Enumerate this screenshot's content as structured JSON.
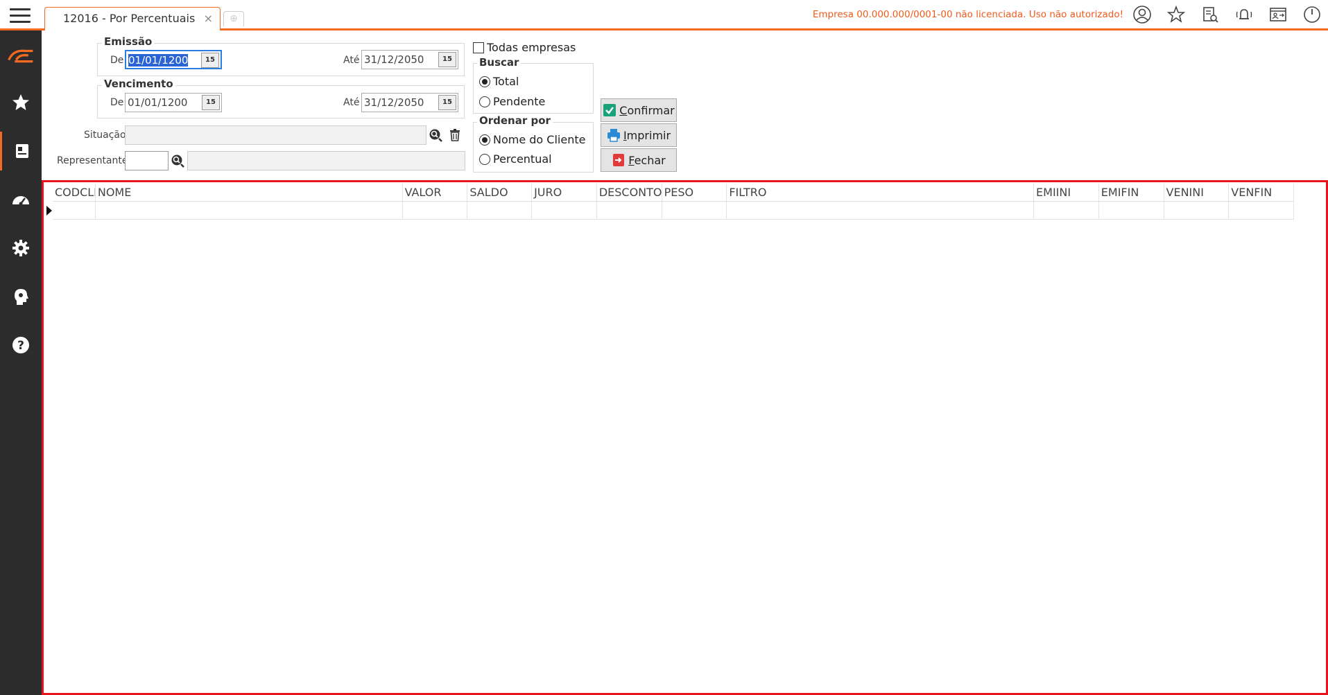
{
  "tab": {
    "title": "12016 - Por Percentuais",
    "close": "×",
    "add": "⊕"
  },
  "license_notice": "Empresa 00.000.000/0001-00 não licenciada. Uso não autorizado!",
  "form": {
    "emissao": {
      "legend": "Emissão",
      "de_label": "De",
      "de_value": "01/01/1200",
      "ate_label": "Até",
      "ate_value": "31/12/2050"
    },
    "vencimento": {
      "legend": "Vencimento",
      "de_label": "De",
      "de_value": "01/01/1200",
      "ate_label": "Até",
      "ate_value": "31/12/2050"
    },
    "calendar_icon": "15",
    "situacao_label": "Situação",
    "representante_label": "Representante",
    "todas_empresas": "Todas empresas",
    "buscar": {
      "legend": "Buscar",
      "options": [
        "Total",
        "Pendente"
      ],
      "selected": "Total"
    },
    "ordenar": {
      "legend": "Ordenar por",
      "options": [
        "Nome do Cliente",
        "Percentual"
      ],
      "selected": "Nome do Cliente"
    }
  },
  "buttons": {
    "confirmar": {
      "accel": "C",
      "rest": "onfirmar"
    },
    "imprimir": {
      "accel": "I",
      "rest": "mprimir"
    },
    "fechar": {
      "accel": "F",
      "rest": "echar"
    }
  },
  "grid": {
    "columns": [
      "CODCLI",
      "NOME",
      "VALOR",
      "SALDO",
      "JURO",
      "DESCONTO",
      "PESO",
      "FILTRO",
      "EMIINI",
      "EMIFIN",
      "VENINI",
      "VENFIN"
    ]
  },
  "colors": {
    "accent": "#f26b21",
    "highlight_border": "#e8141b",
    "sidebar": "#2c2c2c"
  }
}
